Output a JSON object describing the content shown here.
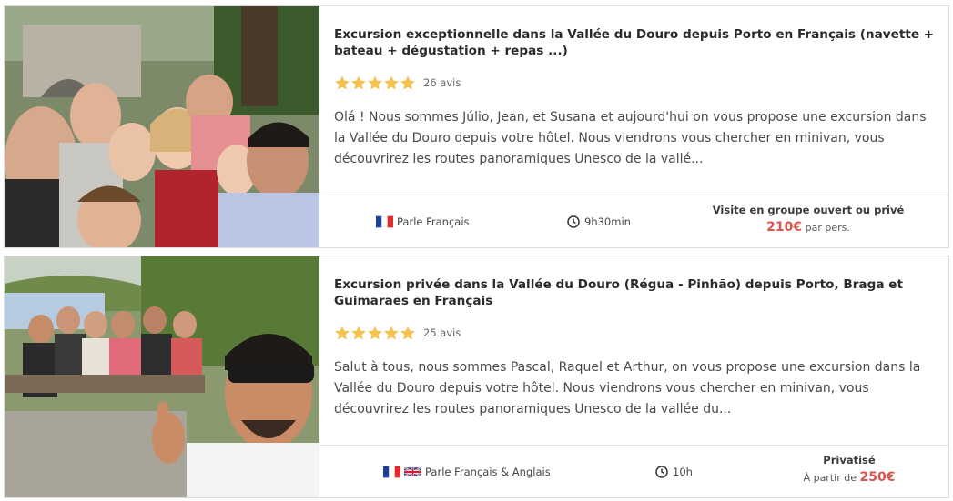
{
  "cards": [
    {
      "title": "Excursion exceptionnelle dans la Vallée du Douro depuis Porto en Français (navette + bateau + dégustation + repas ...)",
      "rating": 5,
      "reviews": "26 avis",
      "description": "Olá ! Nous sommes Júlio, Jean, et Susana et aujourd'hui on vous propose une excursion dans la Vallée du Douro depuis votre hôtel. Nous viendrons vous chercher en minivan, vous découvrirez les routes panoramiques Unesco de la vallé...",
      "language_label": "Parle Français",
      "flags": [
        "fr-flag-icon"
      ],
      "duration": "9h30min",
      "price_type": "Visite en groupe ouvert ou privé",
      "price_prefix": "",
      "price": "210€",
      "price_suffix": "par pers."
    },
    {
      "title": "Excursion privée dans la Vallée du Douro (Régua - Pinhão) depuis Porto, Braga et Guimarães en Français",
      "rating": 5,
      "reviews": "25 avis",
      "description": "Salut à tous, nous sommes Pascal, Raquel et Arthur, on vous propose une excursion dans la Vallée du Douro depuis votre hôtel. Nous viendrons vous chercher en minivan, vous découvrirez les routes panoramiques Unesco de la vallée du...",
      "language_label": "Parle Français & Anglais",
      "flags": [
        "fr-flag-icon",
        "uk-flag-icon"
      ],
      "duration": "10h",
      "price_type": "Privatisé",
      "price_prefix": "À partir de",
      "price": "250€",
      "price_suffix": ""
    }
  ],
  "colors": {
    "star": "#f5c24f",
    "price": "#d9534f",
    "border": "#dcdcdc"
  }
}
